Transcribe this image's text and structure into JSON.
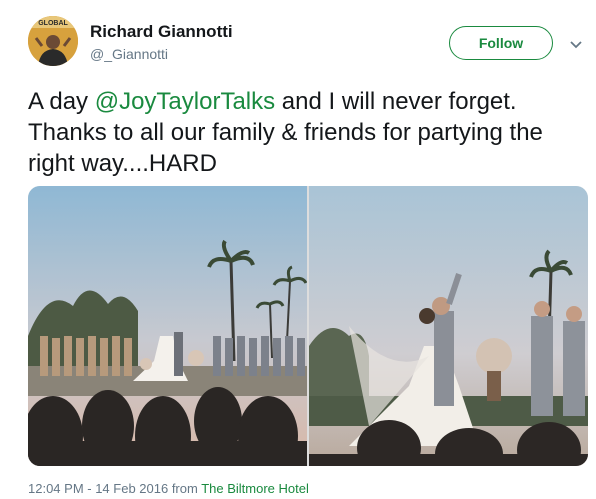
{
  "author": {
    "name": "Richard Giannotti",
    "handle": "@_Giannotti",
    "avatar_text": "GLOBAL"
  },
  "follow_label": "Follow",
  "tweet": {
    "text_before": "A day ",
    "mention": "@JoyTaylorTalks",
    "text_after": " and I will never forget. Thanks to all our family & friends for partying the right way....HARD"
  },
  "footer": {
    "time_date": "12:04 PM - 14 Feb 2016",
    "from_word": " from ",
    "source": "The Biltmore Hotel"
  },
  "colors": {
    "accent": "#1a8a3f",
    "secondary_text": "#657786"
  },
  "icons": [
    "chevron-down-icon"
  ]
}
